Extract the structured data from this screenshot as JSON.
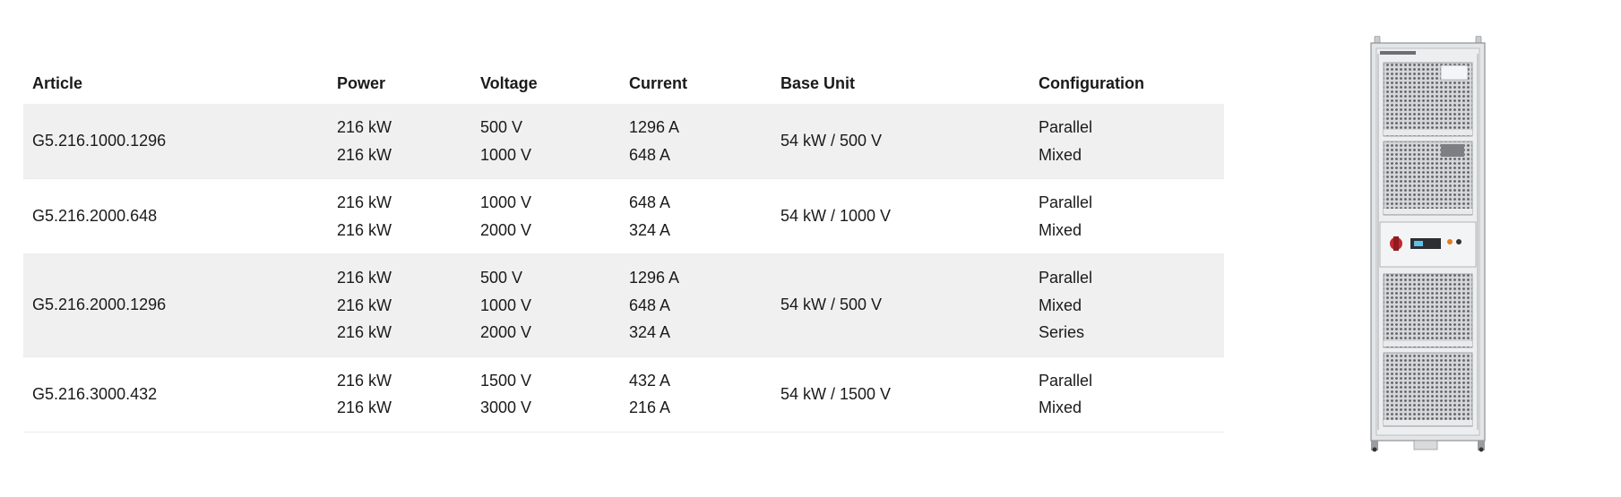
{
  "table": {
    "headers": {
      "article": "Article",
      "power": "Power",
      "voltage": "Voltage",
      "current": "Current",
      "base_unit": "Base Unit",
      "configuration": "Configuration"
    },
    "rows": [
      {
        "article": "G5.216.1000.1296",
        "power": [
          "216 kW",
          "216 kW"
        ],
        "voltage": [
          "500 V",
          "1000 V"
        ],
        "current": [
          "1296 A",
          "648 A"
        ],
        "base_unit": "54 kW / 500 V",
        "configuration": [
          "Parallel",
          "Mixed"
        ]
      },
      {
        "article": "G5.216.2000.648",
        "power": [
          "216 kW",
          "216 kW"
        ],
        "voltage": [
          "1000 V",
          "2000 V"
        ],
        "current": [
          "648 A",
          "324 A"
        ],
        "base_unit": "54 kW / 1000 V",
        "configuration": [
          "Parallel",
          "Mixed"
        ]
      },
      {
        "article": "G5.216.2000.1296",
        "power": [
          "216 kW",
          "216 kW",
          "216 kW"
        ],
        "voltage": [
          "500 V",
          "1000 V",
          "2000 V"
        ],
        "current": [
          "1296 A",
          "648 A",
          "324 A"
        ],
        "base_unit": "54 kW / 500 V",
        "configuration": [
          "Parallel",
          "Mixed",
          "Series"
        ]
      },
      {
        "article": "G5.216.3000.432",
        "power": [
          "216 kW",
          "216 kW"
        ],
        "voltage": [
          "1500 V",
          "3000 V"
        ],
        "current": [
          "432 A",
          "216 A"
        ],
        "base_unit": "54 kW / 1500 V",
        "configuration": [
          "Parallel",
          "Mixed"
        ]
      }
    ]
  },
  "image": {
    "icon": "power-cabinet-icon"
  }
}
